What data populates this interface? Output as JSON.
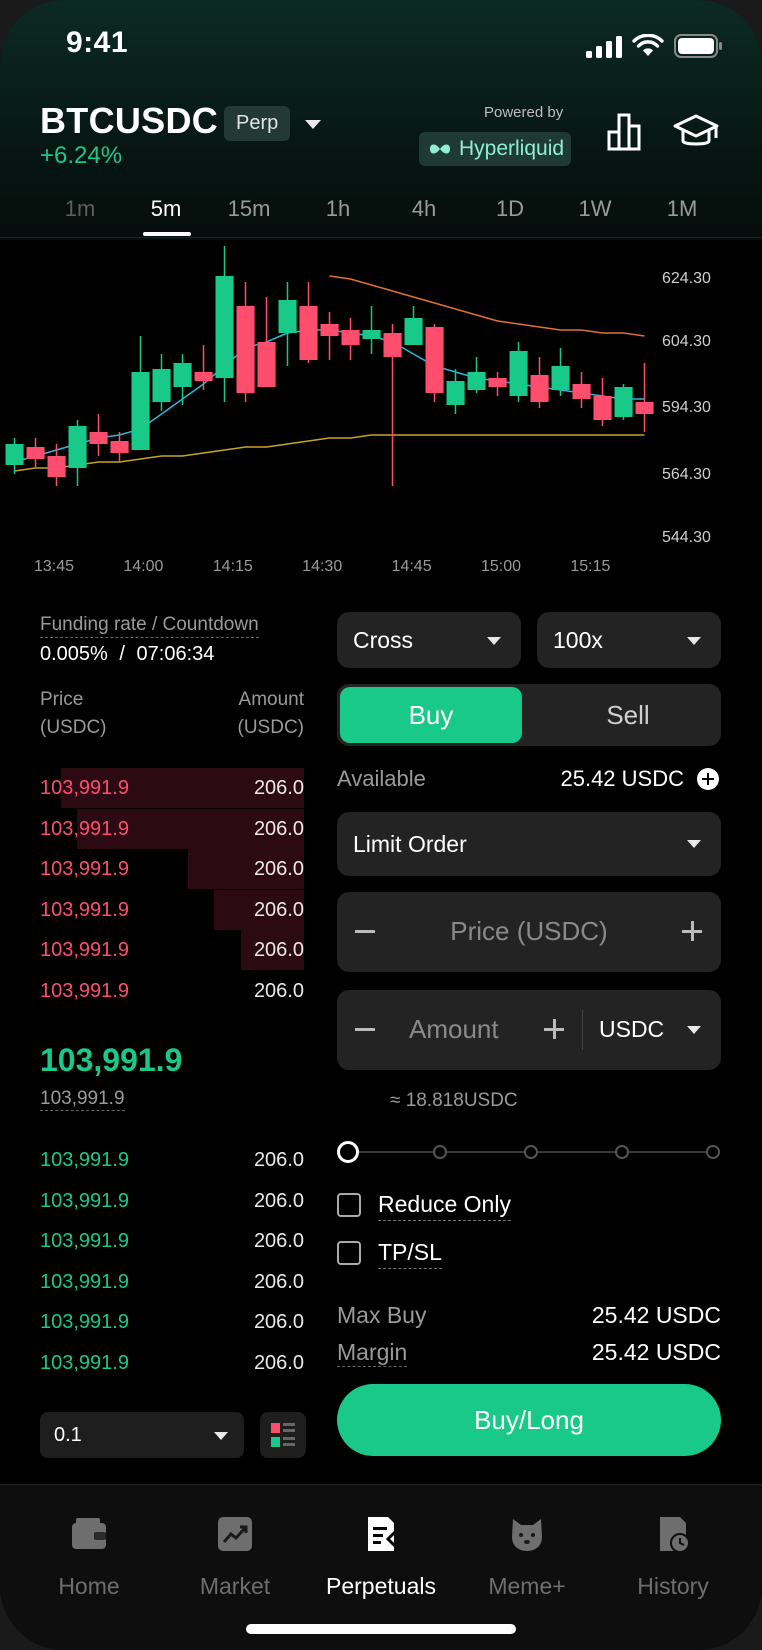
{
  "status_bar": {
    "time": "9:41"
  },
  "header": {
    "pair": "BTCUSDC",
    "badge": "Perp",
    "change": "+6.24%",
    "powered_by": "Powered by",
    "provider": "Hyperliquid"
  },
  "timeframes": [
    "1m",
    "5m",
    "15m",
    "1h",
    "4h",
    "1D",
    "1W",
    "1M"
  ],
  "timeframe_selected": "5m",
  "chart": {
    "y_ticks": [
      "624.30",
      "604.30",
      "594.30",
      "564.30",
      "544.30"
    ],
    "x_ticks": [
      "13:45",
      "14:00",
      "14:15",
      "14:30",
      "14:45",
      "15:00",
      "15:15"
    ]
  },
  "chart_data": {
    "type": "candlestick",
    "x": [
      "13:45",
      "14:00",
      "14:15",
      "14:30",
      "14:45",
      "15:00",
      "15:15"
    ],
    "candles": [
      {
        "o": 559,
        "c": 566,
        "h": 568,
        "l": 556
      },
      {
        "o": 565,
        "c": 561,
        "h": 568,
        "l": 558
      },
      {
        "o": 562,
        "c": 555,
        "h": 566,
        "l": 552
      },
      {
        "o": 558,
        "c": 572,
        "h": 574,
        "l": 552
      },
      {
        "o": 570,
        "c": 566,
        "h": 576,
        "l": 562
      },
      {
        "o": 567,
        "c": 563,
        "h": 570,
        "l": 560
      },
      {
        "o": 564,
        "c": 590,
        "h": 602,
        "l": 564
      },
      {
        "o": 580,
        "c": 591,
        "h": 596,
        "l": 577
      },
      {
        "o": 585,
        "c": 593,
        "h": 596,
        "l": 579
      },
      {
        "o": 590,
        "c": 587,
        "h": 599,
        "l": 584
      },
      {
        "o": 588,
        "c": 622,
        "h": 632,
        "l": 580
      },
      {
        "o": 612,
        "c": 583,
        "h": 620,
        "l": 580
      },
      {
        "o": 600,
        "c": 585,
        "h": 615,
        "l": 585
      },
      {
        "o": 603,
        "c": 614,
        "h": 620,
        "l": 592
      },
      {
        "o": 612,
        "c": 594,
        "h": 620,
        "l": 593
      },
      {
        "o": 606,
        "c": 602,
        "h": 610,
        "l": 594
      },
      {
        "o": 604,
        "c": 599,
        "h": 608,
        "l": 594
      },
      {
        "o": 601,
        "c": 604,
        "h": 612,
        "l": 596
      },
      {
        "o": 603,
        "c": 595,
        "h": 606,
        "l": 552
      },
      {
        "o": 599,
        "c": 608,
        "h": 612,
        "l": 599
      },
      {
        "o": 605,
        "c": 583,
        "h": 606,
        "l": 580
      },
      {
        "o": 579,
        "c": 587,
        "h": 591,
        "l": 576
      },
      {
        "o": 584,
        "c": 590,
        "h": 595,
        "l": 583
      },
      {
        "o": 588,
        "c": 585,
        "h": 590,
        "l": 582
      },
      {
        "o": 582,
        "c": 597,
        "h": 600,
        "l": 580
      },
      {
        "o": 589,
        "c": 580,
        "h": 595,
        "l": 578
      },
      {
        "o": 584,
        "c": 592,
        "h": 598,
        "l": 582
      },
      {
        "o": 586,
        "c": 581,
        "h": 590,
        "l": 578
      },
      {
        "o": 582,
        "c": 574,
        "h": 588,
        "l": 572
      },
      {
        "o": 575,
        "c": 585,
        "h": 586,
        "l": 574
      },
      {
        "o": 580,
        "c": 576,
        "h": 593,
        "l": 570
      }
    ],
    "ylim": [
      540,
      630
    ],
    "series": [
      {
        "name": "",
        "color": "#e0703a",
        "values": [
          null,
          null,
          null,
          null,
          null,
          null,
          null,
          null,
          null,
          null,
          null,
          null,
          null,
          null,
          null,
          622,
          621,
          619,
          617,
          615,
          613,
          611,
          609,
          607,
          606,
          605,
          604,
          604,
          603,
          603,
          602
        ]
      },
      {
        "name": "",
        "color": "#2fb6d8",
        "values": [
          560,
          562,
          564,
          566,
          568,
          569,
          571,
          576,
          581,
          586,
          592,
          598,
          600,
          603,
          604,
          604,
          603,
          602,
          600,
          596,
          592,
          590,
          588,
          587,
          586,
          585,
          584,
          583,
          582,
          581,
          581
        ]
      },
      {
        "name": "",
        "color": "#c9a227",
        "values": [
          557,
          558,
          558,
          559,
          560,
          560,
          561,
          562,
          562,
          563,
          564,
          565,
          565,
          566,
          567,
          568,
          568,
          569,
          569,
          569,
          569,
          569,
          569,
          569,
          569,
          569,
          569,
          569,
          569,
          569,
          569
        ]
      }
    ]
  },
  "funding": {
    "label": "Funding rate / Countdown",
    "rate": "0.005%",
    "separator": "/",
    "countdown": "07:06:34"
  },
  "orderbook": {
    "price_header": "Price",
    "price_unit": "(USDC)",
    "amount_header": "Amount",
    "amount_unit": "(USDC)",
    "asks": [
      {
        "price": "103,991.9",
        "amount": "206.0",
        "depth": 0.92
      },
      {
        "price": "103,991.9",
        "amount": "206.0",
        "depth": 0.86
      },
      {
        "price": "103,991.9",
        "amount": "206.0",
        "depth": 0.44
      },
      {
        "price": "103,991.9",
        "amount": "206.0",
        "depth": 0.34
      },
      {
        "price": "103,991.9",
        "amount": "206.0",
        "depth": 0.24
      },
      {
        "price": "103,991.9",
        "amount": "206.0",
        "depth": 0.0
      }
    ],
    "mid_price": "103,991.9",
    "mark_price": "103,991.9",
    "bids": [
      {
        "price": "103,991.9",
        "amount": "206.0"
      },
      {
        "price": "103,991.9",
        "amount": "206.0"
      },
      {
        "price": "103,991.9",
        "amount": "206.0"
      },
      {
        "price": "103,991.9",
        "amount": "206.0"
      },
      {
        "price": "103,991.9",
        "amount": "206.0"
      },
      {
        "price": "103,991.9",
        "amount": "206.0"
      }
    ],
    "step": "0.1"
  },
  "trade": {
    "margin_mode": "Cross",
    "leverage": "100x",
    "buy_label": "Buy",
    "sell_label": "Sell",
    "available_label": "Available",
    "available_value": "25.42 USDC",
    "order_type": "Limit Order",
    "price_placeholder": "Price (USDC)",
    "amount_placeholder": "Amount",
    "amount_unit": "USDC",
    "approx": "≈ 18.818USDC",
    "slider_value": 0,
    "reduce_only": "Reduce Only",
    "tpsl": "TP/SL",
    "max_buy_label": "Max Buy",
    "max_buy_value": "25.42 USDC",
    "margin_label": "Margin",
    "margin_value": "25.42 USDC",
    "submit": "Buy/Long"
  },
  "tabbar": {
    "tabs": [
      {
        "label": "Home",
        "icon": "wallet-icon"
      },
      {
        "label": "Market",
        "icon": "chart-trend-icon"
      },
      {
        "label": "Perpetuals",
        "icon": "perpetuals-icon"
      },
      {
        "label": "Meme+",
        "icon": "dog-face-icon"
      },
      {
        "label": "History",
        "icon": "history-icon"
      }
    ],
    "active": "Perpetuals"
  },
  "colors": {
    "up": "#18c98a",
    "down": "#ff4d6d",
    "background": "#000000"
  }
}
